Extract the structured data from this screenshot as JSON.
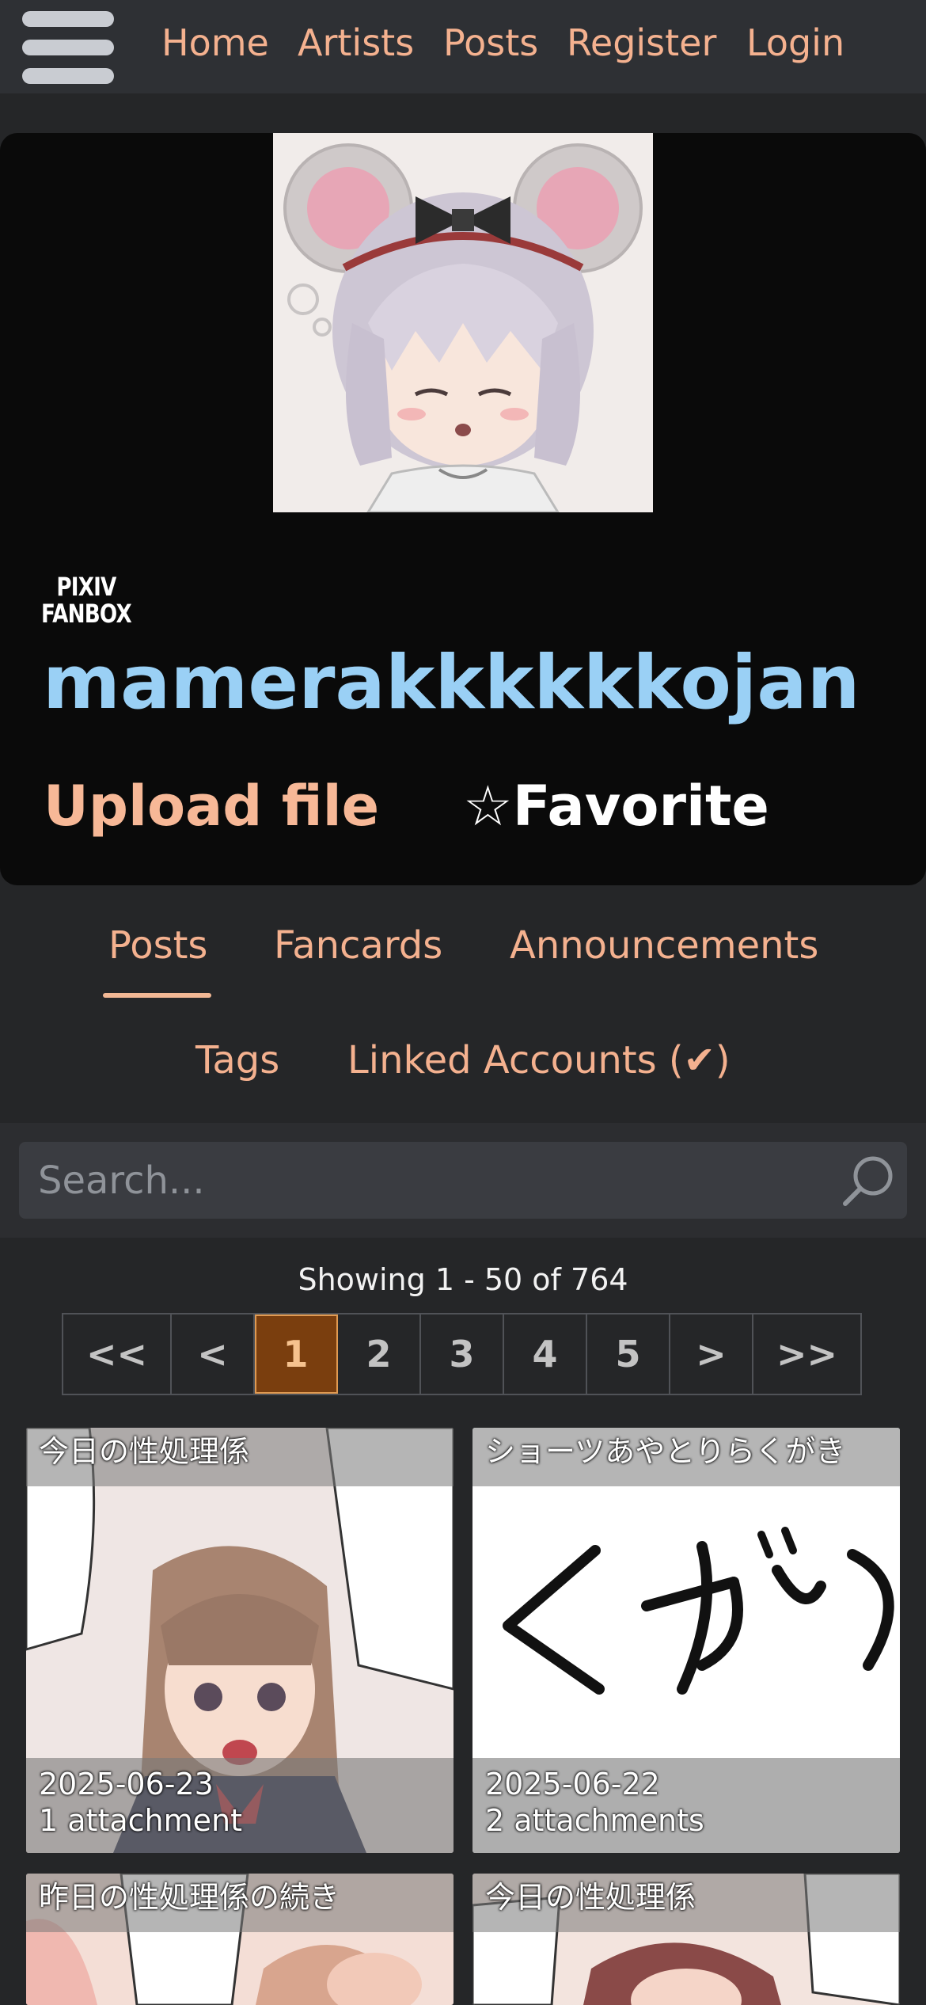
{
  "nav": {
    "links": [
      "Home",
      "Artists",
      "Posts",
      "Register",
      "Login"
    ]
  },
  "artist": {
    "service_lines": [
      "PIXIV",
      "FANBOX"
    ],
    "name": "mamerakkkkkkojan",
    "upload_label": "Upload file",
    "favorite_star": "☆",
    "favorite_label": "Favorite"
  },
  "tabs": {
    "row1": [
      "Posts",
      "Fancards",
      "Announcements"
    ],
    "row2": [
      "Tags",
      "Linked Accounts (✔)"
    ],
    "active": "Posts"
  },
  "search": {
    "placeholder": "Search..."
  },
  "pagination": {
    "showing": "Showing 1 - 50 of 764",
    "buttons": [
      "<<",
      "<",
      "1",
      "2",
      "3",
      "4",
      "5",
      ">",
      ">>"
    ],
    "current": "1"
  },
  "posts": [
    {
      "title": "今日の性処理係",
      "date": "2025-06-23",
      "attachments": "1 attachment"
    },
    {
      "title": "ショーツあやとりらくがき",
      "date": "2025-06-22",
      "attachments": "2 attachments"
    },
    {
      "title": "昨日の性処理係の続き",
      "date": "",
      "attachments": ""
    },
    {
      "title": "今日の性処理係",
      "date": "",
      "attachments": ""
    }
  ],
  "colors": {
    "accent": "#f4b18f",
    "artist_name": "#9ad0f5",
    "active_page_bg": "#7a3e0e",
    "background": "#252628"
  },
  "icons": [
    "hamburger-menu-icon",
    "search-icon",
    "star-icon"
  ]
}
